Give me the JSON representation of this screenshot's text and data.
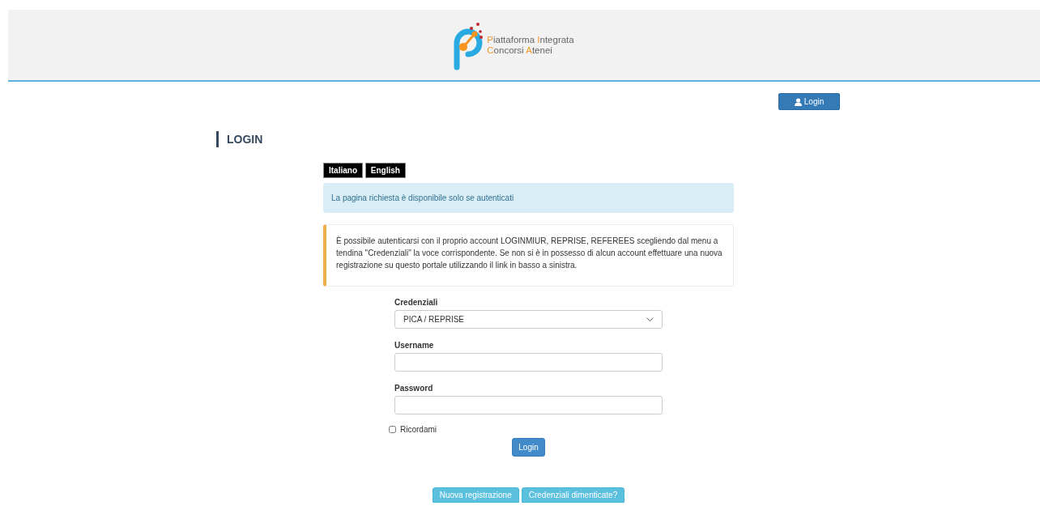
{
  "header": {
    "logo_lines": [
      "Piattaforma Integrata",
      "Concorsi Atenei"
    ]
  },
  "top_button": {
    "label": "Login"
  },
  "page_title": "LOGIN",
  "languages": [
    {
      "label": "Italiano"
    },
    {
      "label": "English"
    }
  ],
  "info_alert": "La pagina richiesta è disponibile solo se autenticati",
  "notice": "È possibile autenticarsi con il proprio account LOGINMIUR, REPRISE, REFEREES scegliendo dal menu a tendina \"Credenziali\" la voce corrispondente. Se non si è in possesso di alcun account effettuare una nuova registrazione su questo portale utilizzando il link in basso a sinistra.",
  "form": {
    "fields": [
      {
        "kind": "select",
        "label": "Credenziali",
        "value": "PICA / REPRISE"
      },
      {
        "kind": "text",
        "label": "Username"
      },
      {
        "kind": "password",
        "label": "Password"
      }
    ],
    "remember": {
      "label": "Ricordami",
      "checked": false
    },
    "submit": "Login"
  },
  "bottom_buttons": [
    "Nuova registrazione",
    "Credenziali dimenticate?"
  ]
}
